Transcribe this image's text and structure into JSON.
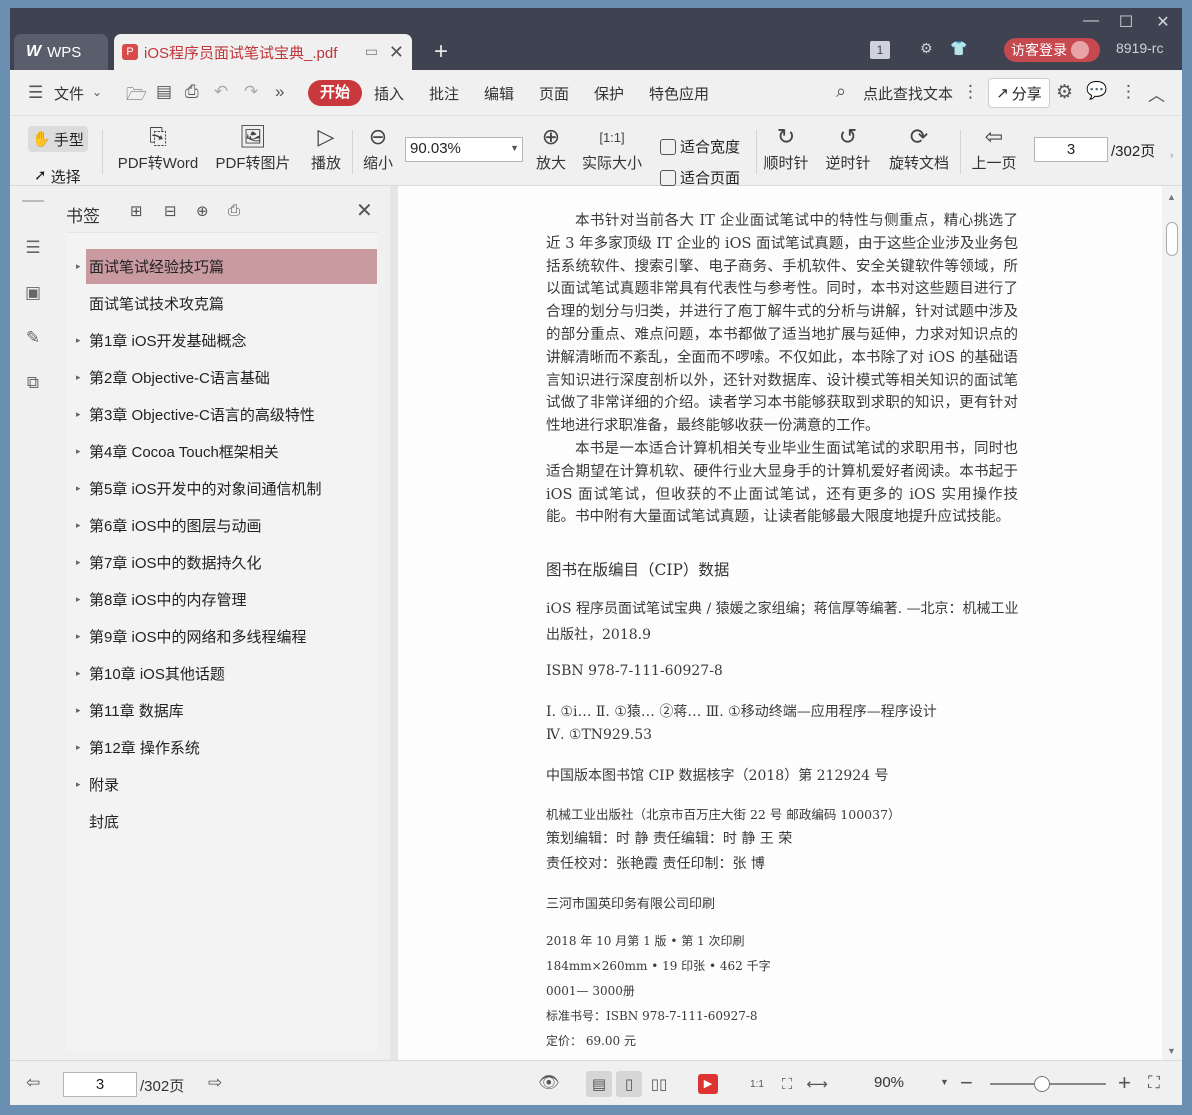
{
  "window_controls": {
    "minimize": "—",
    "maximize": "☐",
    "close": "✕"
  },
  "tabs": {
    "home_label": "WPS",
    "doc_label": "iOS程序员面试笔试宝典_.pdf",
    "new_tab": "+"
  },
  "titlebar_right": {
    "badge": "1",
    "visitor_login": "访客登录",
    "user_id": "8919-rc"
  },
  "menubar": {
    "file": "文件",
    "items": [
      "开始",
      "插入",
      "批注",
      "编辑",
      "页面",
      "保护",
      "特色应用"
    ],
    "search": "点此查找文本",
    "share": "分享"
  },
  "toolbar": {
    "hand": "手型",
    "select": "选择",
    "pdf_to_word": "PDF转Word",
    "pdf_to_image": "PDF转图片",
    "play": "播放",
    "zoom_out": "缩小",
    "zoom_value": "90.03%",
    "zoom_in": "放大",
    "actual_size": "实际大小",
    "fit_width": "适合宽度",
    "fit_page": "适合页面",
    "rotate_cw": "顺时针",
    "rotate_ccw": "逆时针",
    "rotate_doc": "旋转文档",
    "prev_page": "上一页",
    "page_current": "3",
    "page_total": "/302页"
  },
  "bookmarks": {
    "title": "书签",
    "items": [
      {
        "label": "面试笔试经验技巧篇",
        "expandable": true,
        "active": true
      },
      {
        "label": "面试笔试技术攻克篇",
        "expandable": false,
        "active": false
      },
      {
        "label": "第1章  iOS开发基础概念",
        "expandable": true,
        "active": false
      },
      {
        "label": "第2章  Objective-C语言基础",
        "expandable": true,
        "active": false
      },
      {
        "label": "第3章  Objective-C语言的高级特性",
        "expandable": true,
        "active": false
      },
      {
        "label": "第4章  Cocoa Touch框架相关",
        "expandable": true,
        "active": false
      },
      {
        "label": "第5章  iOS开发中的对象间通信机制",
        "expandable": true,
        "active": false
      },
      {
        "label": "第6章  iOS中的图层与动画",
        "expandable": true,
        "active": false
      },
      {
        "label": "第7章  iOS中的数据持久化",
        "expandable": true,
        "active": false
      },
      {
        "label": "第8章  iOS中的内存管理",
        "expandable": true,
        "active": false
      },
      {
        "label": "第9章  iOS中的网络和多线程编程",
        "expandable": true,
        "active": false
      },
      {
        "label": "第10章  iOS其他话题",
        "expandable": true,
        "active": false
      },
      {
        "label": "第11章  数据库",
        "expandable": true,
        "active": false
      },
      {
        "label": "第12章  操作系统",
        "expandable": true,
        "active": false
      },
      {
        "label": "附录",
        "expandable": true,
        "active": false
      },
      {
        "label": "封底",
        "expandable": false,
        "active": false
      }
    ]
  },
  "document": {
    "para1": "本书针对当前各大 IT 企业面试笔试中的特性与侧重点，精心挑选了近 3 年多家顶级 IT 企业的 iOS 面试笔试真题，由于这些企业涉及业务包括系统软件、搜索引擎、电子商务、手机软件、安全关键软件等领域，所以面试笔试真题非常具有代表性与参考性。同时，本书对这些题目进行了合理的划分与归类，并进行了庖丁解牛式的分析与讲解，针对试题中涉及的部分重点、难点问题，本书都做了适当地扩展与延伸，力求对知识点的讲解清晰而不紊乱，全面而不啰嗦。不仅如此，本书除了对 iOS 的基础语言知识进行深度剖析以外，还针对数据库、设计模式等相关知识的面试笔试做了非常详细的介绍。读者学习本书能够获取到求职的知识，更有针对性地进行求职准备，最终能够收获一份满意的工作。",
    "para2": "本书是一本适合计算机相关专业毕业生面试笔试的求职用书，同时也适合期望在计算机软、硬件行业大显身手的计算机爱好者阅读。本书起于 iOS 面试笔试，但收获的不止面试笔试，还有更多的 iOS 实用操作技能。书中附有大量面试笔试真题，让读者能够最大限度地提升应试技能。",
    "cip_heading": "图书在版编目（CIP）数据",
    "cip_line1": "iOS 程序员面试笔试宝典 / 猿媛之家组编；蒋信厚等编著. —北京：机械工业",
    "cip_line2": "出版社，2018.9",
    "isbn": "ISBN 978-7-111-60927-8",
    "class1": "Ⅰ. ①i…   Ⅱ. ①猿…  ②蒋…   Ⅲ. ①移动终端—应用程序—程序设计",
    "class2": "Ⅳ. ①TN929.53",
    "cip_no": "中国版本图书馆 CIP 数据核字（2018）第 212924 号",
    "publisher": "机械工业出版社（北京市百万庄大街 22 号   邮政编码 100037）",
    "editors1": "策划编辑：时   静        责任编辑：时   静   王   荣",
    "editors2": "责任校对：张艳霞        责任印制：张   博",
    "printer": "三河市国英印务有限公司印刷",
    "edition": "2018 年 10 月第 1 版 • 第 1 次印刷",
    "format": "184mm×260mm • 19 印张 • 462 千字",
    "copies": "0001— 3000册",
    "std_no": "标准书号：ISBN 978-7-111-60927-8",
    "price": "定价：  69.00 元"
  },
  "statusbar": {
    "page_current": "3",
    "page_total": "/302页",
    "zoom": "90%",
    "zoom_level": 0.45
  }
}
